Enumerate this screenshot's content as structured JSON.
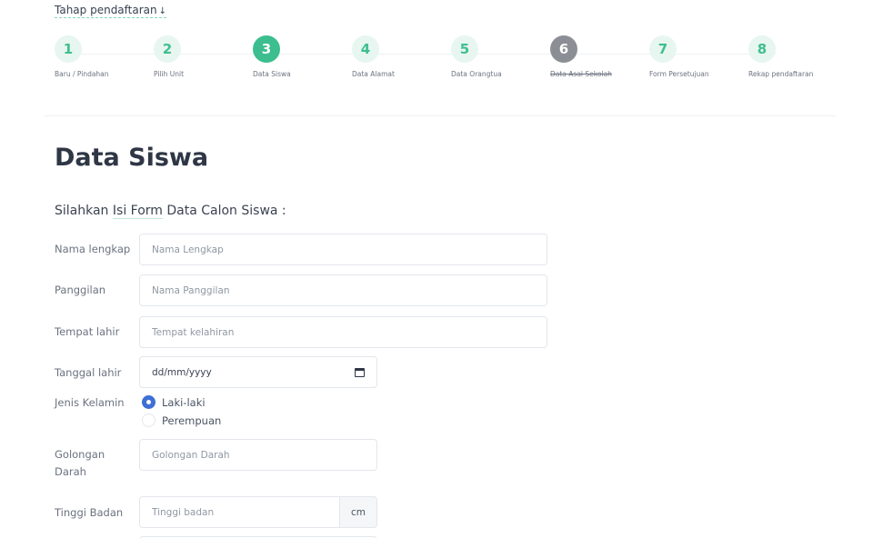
{
  "steps_title": "Tahap pendaftaran",
  "steps": [
    {
      "num": "1",
      "label": "Baru / Pindahan",
      "state": "default"
    },
    {
      "num": "2",
      "label": "Pilih Unit",
      "state": "default"
    },
    {
      "num": "3",
      "label": "Data Siswa",
      "state": "active"
    },
    {
      "num": "4",
      "label": "Data Alamat",
      "state": "default"
    },
    {
      "num": "5",
      "label": "Data Orangtua",
      "state": "default"
    },
    {
      "num": "6",
      "label": "Data Asal Sekolah",
      "state": "disabled"
    },
    {
      "num": "7",
      "label": "Form Persetujuan",
      "state": "default"
    },
    {
      "num": "8",
      "label": "Rekap pendaftaran",
      "state": "default"
    }
  ],
  "page_title": "Data Siswa",
  "form_subtitle": {
    "pre": "Silahkan ",
    "highlight": "Isi Form",
    "post": " Data Calon Siswa :"
  },
  "fields": {
    "nama_lengkap": {
      "label": "Nama lengkap",
      "placeholder": "Nama Lengkap"
    },
    "panggilan": {
      "label": "Panggilan",
      "placeholder": "Nama Panggilan"
    },
    "tempat_lahir": {
      "label": "Tempat lahir",
      "placeholder": "Tempat kelahiran"
    },
    "tanggal_lahir": {
      "label": "Tanggal lahir",
      "value": "dd/mm/yyyy"
    },
    "jenis_kelamin": {
      "label": "Jenis Kelamin",
      "options": [
        "Laki-laki",
        "Perempuan"
      ],
      "selected": "Laki-laki"
    },
    "golongan_darah": {
      "label_line1": "Golongan",
      "label_line2": "Darah",
      "placeholder": "Golongan Darah"
    },
    "tinggi_badan": {
      "label": "Tinggi Badan",
      "placeholder": "Tinggi badan",
      "unit": "cm"
    }
  },
  "colors": {
    "accent": "#3cbe8e",
    "accent_light": "#e7f6f0",
    "disabled": "#8b8e94",
    "radio": "#3d6fd6"
  }
}
